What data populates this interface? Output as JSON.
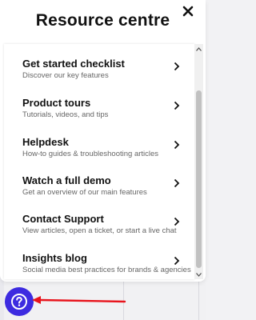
{
  "panel": {
    "title": "Resource centre",
    "items": [
      {
        "title": "Get started checklist",
        "subtitle": "Discover our key features"
      },
      {
        "title": "Product tours",
        "subtitle": "Tutorials, videos, and tips"
      },
      {
        "title": "Helpdesk",
        "subtitle": "How-to guides & troubleshooting articles"
      },
      {
        "title": "Watch a full demo",
        "subtitle": "Get an overview of our main features"
      },
      {
        "title": "Contact Support",
        "subtitle": "View articles, open a ticket, or start a live chat"
      },
      {
        "title": "Insights blog",
        "subtitle": "Social media best practices for brands & agencies"
      }
    ]
  },
  "icons": {
    "close": "close-icon",
    "chevron": "chevron-right-icon",
    "help": "question-mark-icon",
    "arrow": "arrow-left-icon"
  },
  "colors": {
    "accent": "#3d2be0",
    "annotation": "#e8141c"
  }
}
